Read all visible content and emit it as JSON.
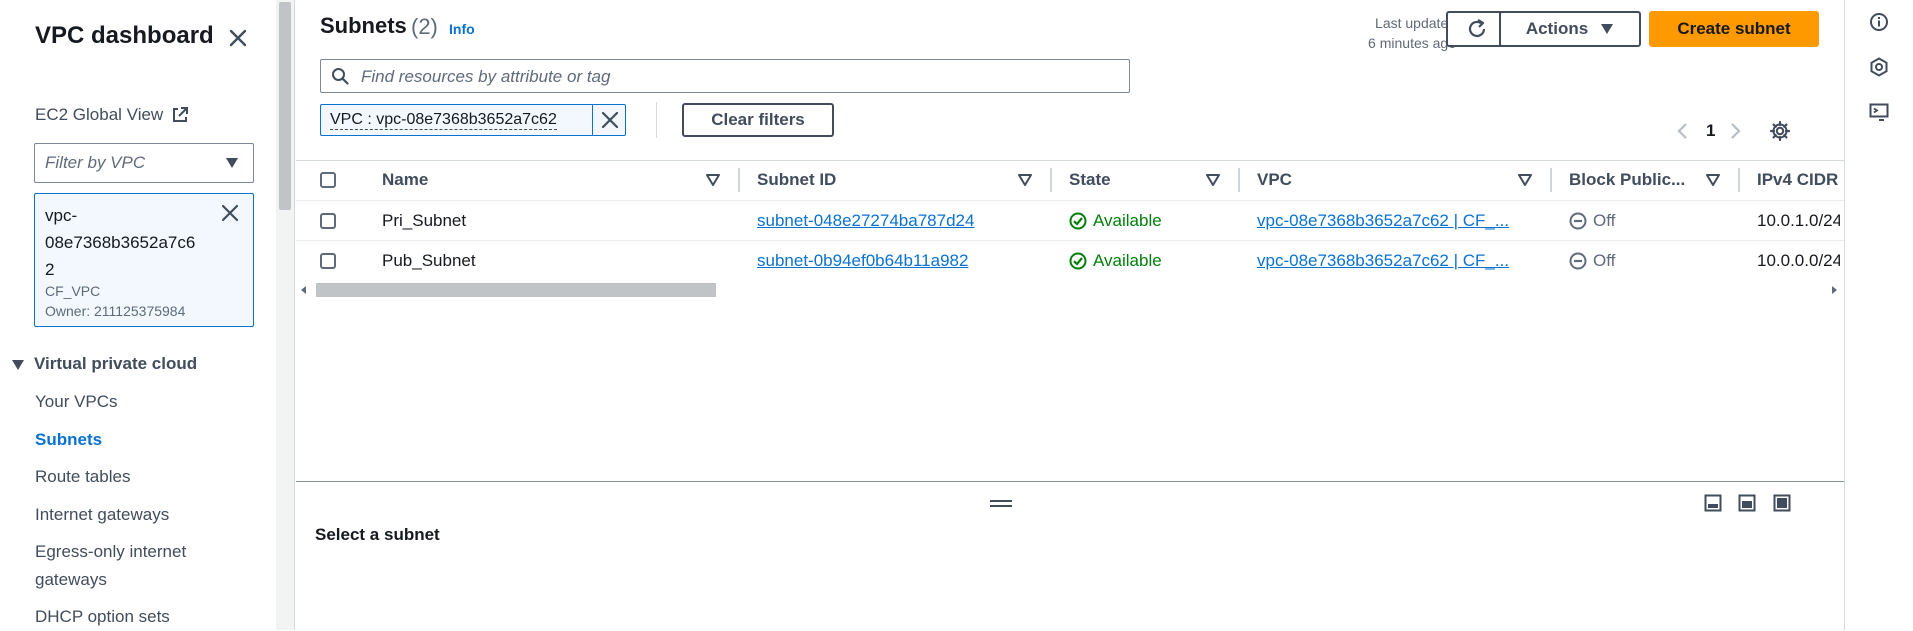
{
  "sidebar": {
    "title": "VPC dashboard",
    "global_view": "EC2 Global View",
    "filter_placeholder": "Filter by VPC",
    "selected_vpc": {
      "id_line1": "vpc-",
      "id_line2": "08e7368b3652a7c6",
      "id_line3": "2",
      "name": "CF_VPC",
      "owner": "Owner: 211125375984"
    },
    "section": "Virtual private cloud",
    "items": [
      {
        "label": "Your VPCs",
        "active": false
      },
      {
        "label": "Subnets",
        "active": true
      },
      {
        "label": "Route tables",
        "active": false
      },
      {
        "label": "Internet gateways",
        "active": false
      },
      {
        "label": "Egress-only internet",
        "active": false
      },
      {
        "label": "gateways",
        "active": false
      },
      {
        "label": "DHCP option sets",
        "active": false
      }
    ]
  },
  "header": {
    "title": "Subnets",
    "count": "(2)",
    "info": "Info",
    "last_updated_label": "Last updated",
    "last_updated_value": "6 minutes ago",
    "actions_label": "Actions",
    "create_label": "Create subnet"
  },
  "search": {
    "placeholder": "Find resources by attribute or tag"
  },
  "filter_token": {
    "text": "VPC : vpc-08e7368b3652a7c62"
  },
  "clear_filters_label": "Clear filters",
  "pagination": {
    "page": "1"
  },
  "table": {
    "columns": [
      "Name",
      "Subnet ID",
      "State",
      "VPC",
      "Block Public...",
      "IPv4 CIDR"
    ],
    "rows": [
      {
        "name": "Pri_Subnet",
        "subnet_id": "subnet-048e27274ba787d24",
        "state": "Available",
        "vpc": "vpc-08e7368b3652a7c62 | CF_...",
        "block": "Off",
        "cidr": "10.0.1.0/24"
      },
      {
        "name": "Pub_Subnet",
        "subnet_id": "subnet-0b94ef0b64b11a982",
        "state": "Available",
        "vpc": "vpc-08e7368b3652a7c62 | CF_...",
        "block": "Off",
        "cidr": "10.0.0.0/24"
      }
    ]
  },
  "detail_panel": {
    "text": "Select a subnet"
  },
  "colors": {
    "accent": "#0972d3",
    "primary": "#ff9900",
    "success": "#037f0c"
  },
  "icons": [
    "close-icon",
    "external-link-icon",
    "caret-down-icon",
    "search-icon",
    "refresh-icon",
    "sort-icon",
    "settings-icon",
    "info-icon",
    "hexagon-icon",
    "notifications-icon",
    "panel-layout-icon"
  ]
}
